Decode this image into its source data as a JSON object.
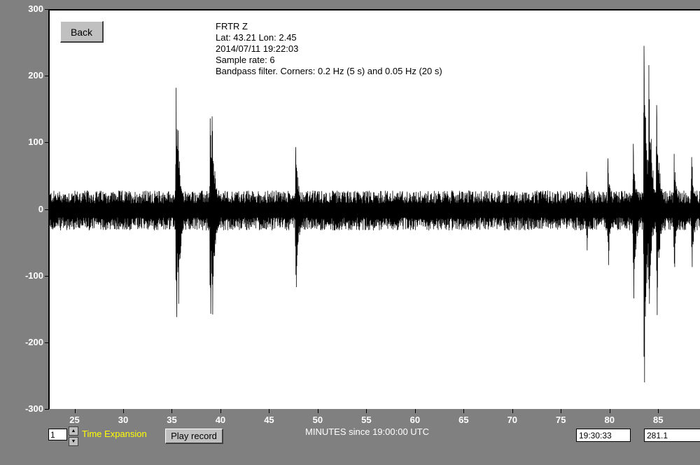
{
  "header": {
    "back_label": "Back",
    "station": "FRTR  Z",
    "location": "Lat: 43.21 Lon: 2.45",
    "datetime": "2014/07/11 19:22:03",
    "sample_rate": "Sample rate: 6",
    "filter": "Bandpass filter. Corners: 0.2 Hz (5 s) and 0.05 Hz (20 s)"
  },
  "controls": {
    "expansion_value": "1",
    "time_expansion_label": "Time Expansion",
    "play_label": "Play record",
    "time_readout": "19:30:33",
    "value_readout": "281.1"
  },
  "colors": {
    "background": "#808080",
    "plot_bg": "#ffffff",
    "trace": "#000000",
    "axis_text": "#ffffff",
    "time_expansion_text": "#ffff00"
  },
  "chart_data": {
    "type": "line",
    "xlabel": "MINUTES since 19:00:00 UTC",
    "ylabel": "",
    "xlim": [
      22.3,
      89.3
    ],
    "ylim": [
      -300,
      300
    ],
    "xticks": [
      25,
      30,
      35,
      40,
      45,
      50,
      55,
      60,
      65,
      70,
      75,
      80,
      85
    ],
    "yticks": [
      300,
      200,
      100,
      0,
      -100,
      -200,
      -300
    ],
    "background_noise_amplitude": 30,
    "events": [
      {
        "x": 35.3,
        "max": 184,
        "min": -160
      },
      {
        "x": 35.5,
        "max": 120,
        "min": -140
      },
      {
        "x": 38.8,
        "max": 138,
        "min": -155
      },
      {
        "x": 39.0,
        "max": 141,
        "min": -156
      },
      {
        "x": 47.6,
        "max": 95,
        "min": -115
      },
      {
        "x": 77.5,
        "max": 58,
        "min": -60
      },
      {
        "x": 79.7,
        "max": 78,
        "min": -82
      },
      {
        "x": 82.3,
        "max": 100,
        "min": -132
      },
      {
        "x": 83.4,
        "max": 247,
        "min": -258
      },
      {
        "x": 83.9,
        "max": 218,
        "min": -140
      },
      {
        "x": 84.7,
        "max": 158,
        "min": -157
      },
      {
        "x": 86.5,
        "max": 85,
        "min": -85
      },
      {
        "x": 88.3,
        "max": 80,
        "min": -85
      }
    ]
  }
}
